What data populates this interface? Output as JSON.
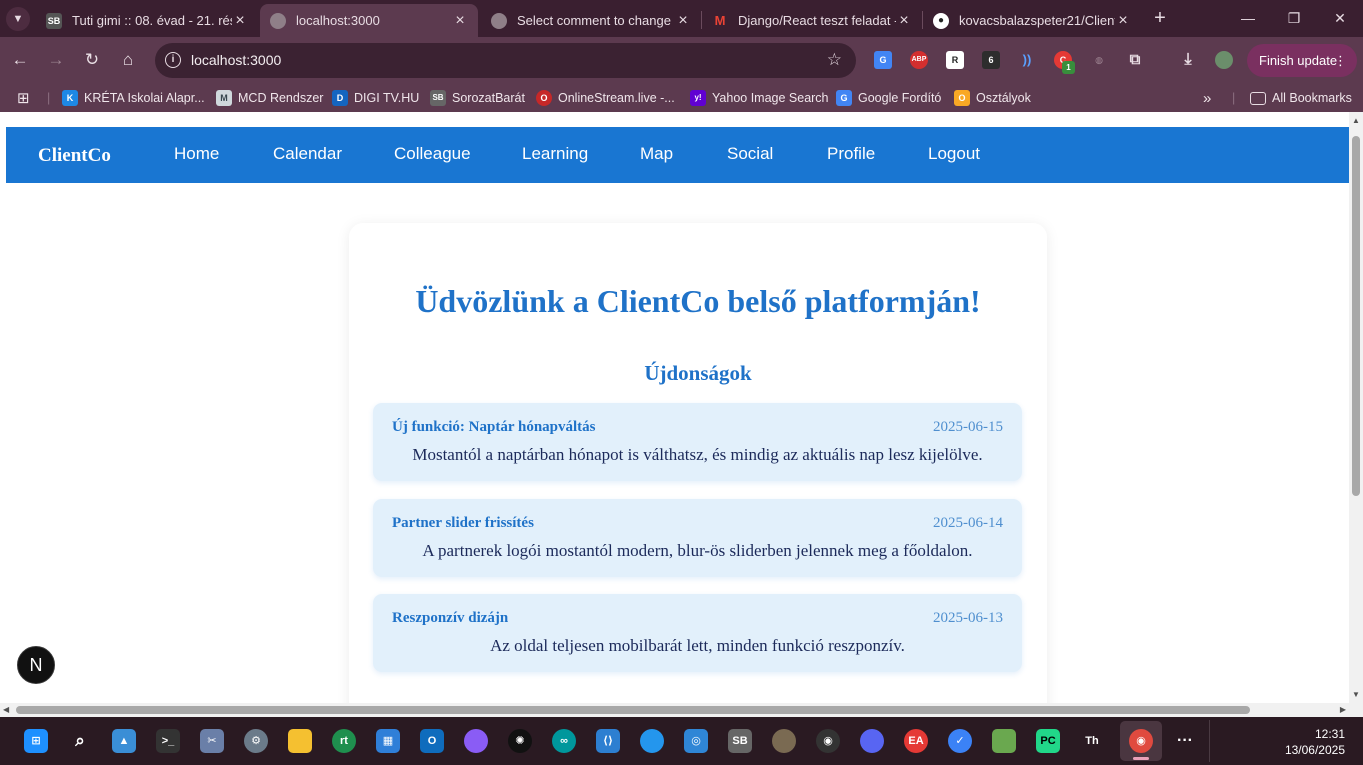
{
  "browser": {
    "tabs": [
      {
        "title": "Tuti gimi :: 08. évad - 21. rés",
        "favicon": "SB",
        "favicon_color": "#555555",
        "active": false
      },
      {
        "title": "localhost:3000",
        "favicon": "globe-icon",
        "active": true
      },
      {
        "title": "Select comment to change |",
        "favicon": "globe-icon",
        "active": false
      },
      {
        "title": "Django/React teszt feladat -",
        "favicon": "gmail-icon",
        "favicon_color": "#ea4335",
        "active": false
      },
      {
        "title": "kovacsbalazspeter21/Client",
        "favicon": "github-icon",
        "active": false
      }
    ],
    "close_glyph": "×",
    "new_tab": "+",
    "url": "localhost:3000",
    "finish_update_label": "Finish update",
    "extension_badge": "1",
    "bookmarks": [
      {
        "label": "KRÉTA Iskolai Alapr...",
        "icon": "K",
        "color": "#1e88e5"
      },
      {
        "label": "MCD Rendszer",
        "icon": "M",
        "color": "#cfd8dc"
      },
      {
        "label": "DIGI TV.HU",
        "icon": "D",
        "color": "#1565c0"
      },
      {
        "label": "SorozatBarát",
        "icon": "SB",
        "color": "#666666"
      },
      {
        "label": "OnlineStream.live -...",
        "icon": "O",
        "color": "#c62828"
      },
      {
        "label": "Yahoo Image Search",
        "icon": "y!",
        "color": "#6001d2"
      },
      {
        "label": "Google Fordító",
        "icon": "G",
        "color": "#4285f4"
      },
      {
        "label": "Osztályok",
        "icon": "O",
        "color": "#f9a825"
      }
    ],
    "all_bookmarks_label": "All Bookmarks"
  },
  "page": {
    "brand": "ClientCo",
    "nav": [
      "Home",
      "Calendar",
      "Colleague",
      "Learning",
      "Map",
      "Social",
      "Profile",
      "Logout"
    ],
    "welcome_title": "Üdvözlünk a ClientCo belső platformján!",
    "news_heading": "Újdonságok",
    "news": [
      {
        "title": "Új funkció: Naptár hónapváltás",
        "date": "2025-06-15",
        "body": "Mostantól a naptárban hónapot is válthatsz, és mindig az aktuális nap lesz kijelölve."
      },
      {
        "title": "Partner slider frissítés",
        "date": "2025-06-14",
        "body": "A partnerek logói mostantól modern, blur-ös sliderben jelennek meg a főoldalon."
      },
      {
        "title": "Reszponzív dizájn",
        "date": "2025-06-13",
        "body": "Az oldal teljesen mobilbarát lett, minden funkció reszponzív."
      }
    ],
    "dev_badge": "N",
    "colors": {
      "navbar": "#1976d2",
      "heading": "#1f72c8",
      "news_bg": "#e2f0fb"
    }
  },
  "taskbar": {
    "time": "12:31",
    "date": "13/06/2025",
    "apps": [
      "start-icon",
      "search-icon",
      "photos-icon",
      "terminal-icon",
      "snipping-icon",
      "settings-icon",
      "file-explorer-icon",
      "rt-icon",
      "store-icon",
      "outlook-icon",
      "copilot-icon",
      "chatgpt-icon",
      "arduino-icon",
      "vscode-icon",
      "docker-icon",
      "app-icon",
      "sorozatbarat-icon",
      "gimp-icon",
      "obs-icon",
      "discord-icon",
      "ea-icon",
      "vpn-icon",
      "notepad-icon",
      "pycharm-icon",
      "typora-icon",
      "chrome-icon"
    ]
  }
}
